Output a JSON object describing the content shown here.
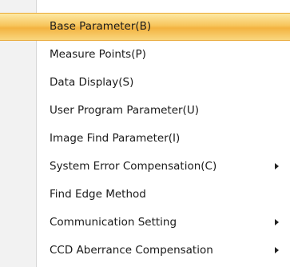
{
  "menu": {
    "items": [
      {
        "label": "Base Parameter(B)",
        "submenu": false,
        "highlighted": true
      },
      {
        "label": "Measure Points(P)",
        "submenu": false,
        "highlighted": false
      },
      {
        "label": "Data Display(S)",
        "submenu": false,
        "highlighted": false
      },
      {
        "label": "User Program Parameter(U)",
        "submenu": false,
        "highlighted": false
      },
      {
        "label": "Image Find Parameter(I)",
        "submenu": false,
        "highlighted": false
      },
      {
        "label": "System Error Compensation(C)",
        "submenu": true,
        "highlighted": false
      },
      {
        "label": "Find Edge Method",
        "submenu": false,
        "highlighted": false
      },
      {
        "label": "Communication Setting",
        "submenu": true,
        "highlighted": false
      },
      {
        "label": "CCD Aberrance Compensation",
        "submenu": true,
        "highlighted": false
      }
    ]
  },
  "icons": {
    "submenu_arrow": "chevron-right-icon"
  },
  "colors": {
    "highlight": "#f7c55c",
    "highlight_border": "#e9a936",
    "gutter": "#f2f2f2",
    "text": "#1a1a1a"
  }
}
